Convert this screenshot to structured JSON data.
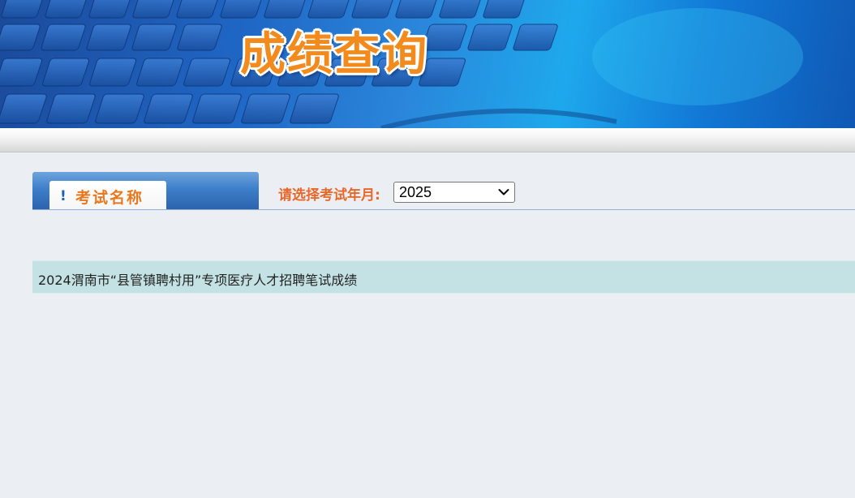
{
  "banner": {
    "title": "成绩查询"
  },
  "tab": {
    "icon": "exclamation-icon",
    "label": "考试名称"
  },
  "year_filter": {
    "label": "请选择考试年月:",
    "selected": "2025"
  },
  "exams": [
    {
      "title": "2024渭南市“县管镇聘村用”专项医疗人才招聘笔试成绩"
    }
  ],
  "colors": {
    "accent_orange": "#e8682a",
    "banner_blue": "#1f66c4",
    "row_bg": "#c4e2e3",
    "page_bg": "#ebeff3"
  }
}
